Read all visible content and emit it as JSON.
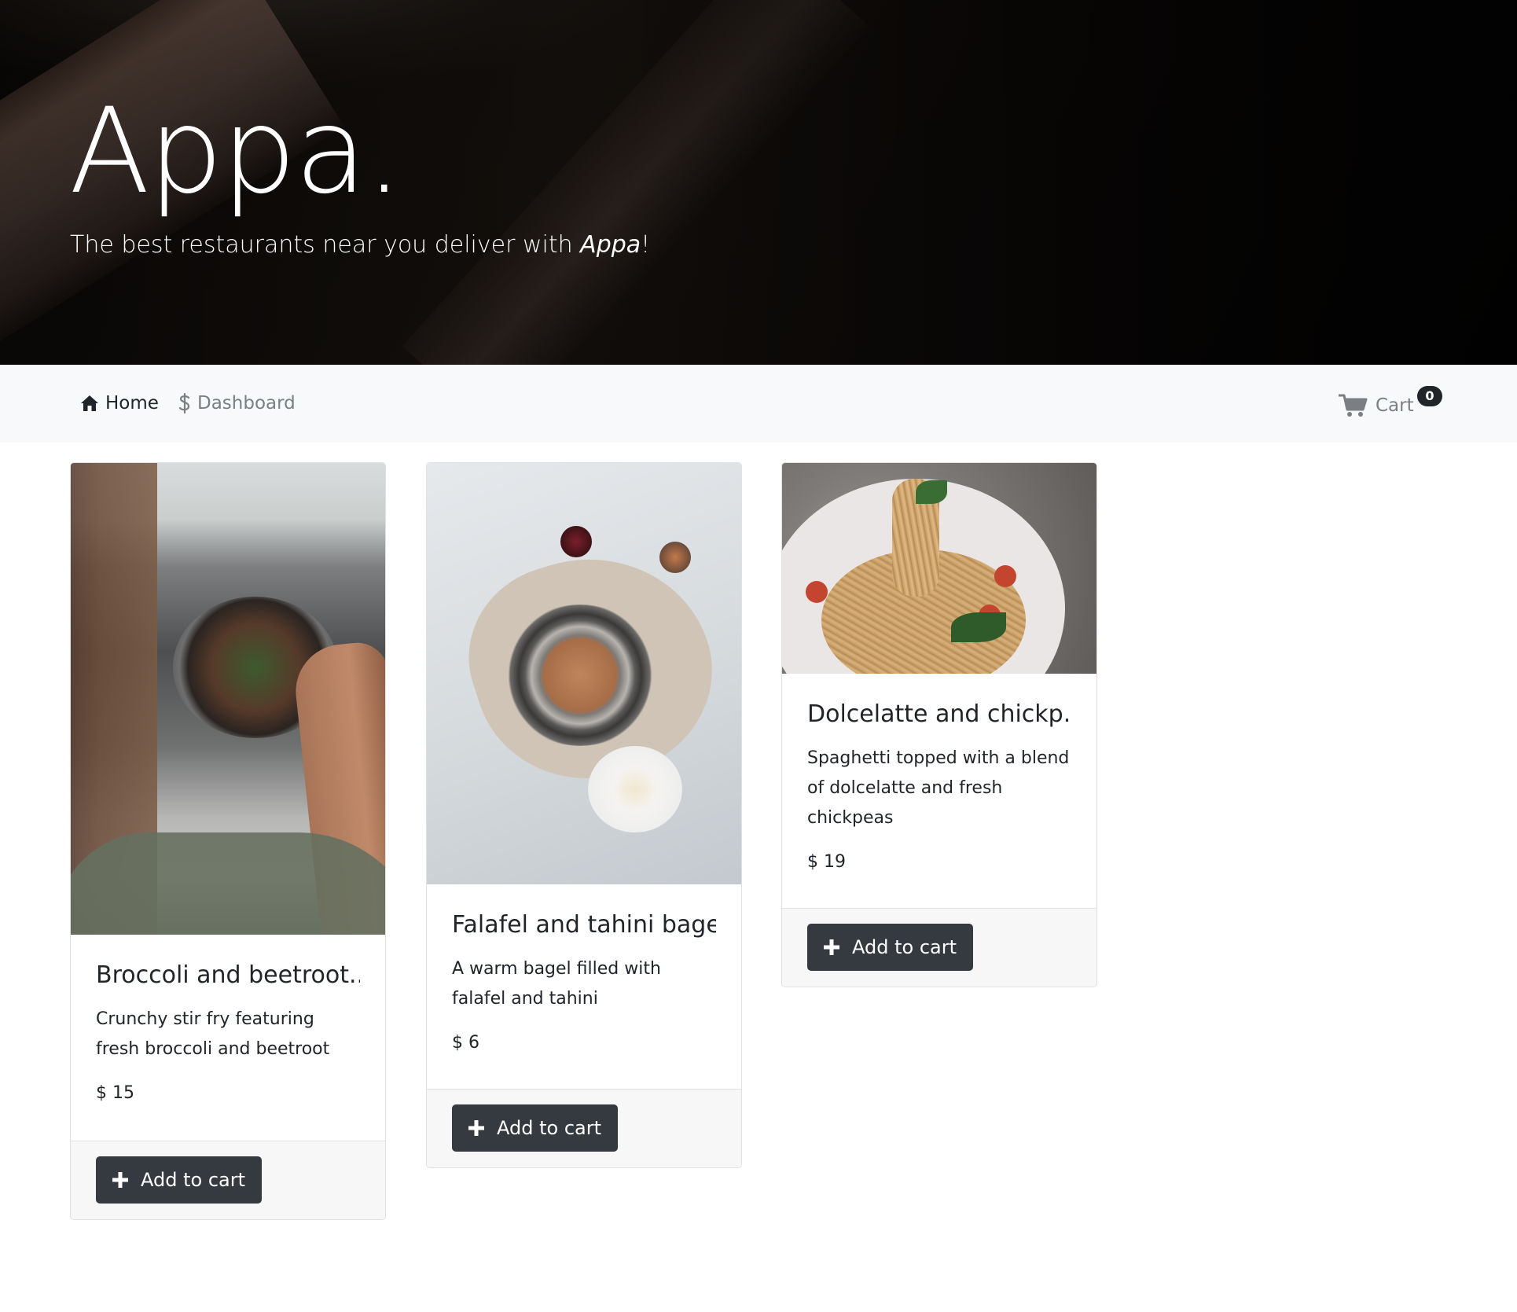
{
  "hero": {
    "title": "Appa.",
    "subtitle_before": "The best restaurants near you deliver with ",
    "subtitle_brand": "Appa",
    "subtitle_after": "!"
  },
  "nav": {
    "home": "Home",
    "dashboard": "Dashboard",
    "cart": "Cart",
    "cart_count": "0"
  },
  "products": [
    {
      "title": "Broccoli and beetroot...",
      "description": "Crunchy stir fry featuring fresh broccoli and beetroot",
      "price": "$ 15",
      "button": "Add to cart"
    },
    {
      "title": "Falafel and tahini bagel",
      "description": "A warm bagel filled with falafel and tahini",
      "price": "$ 6",
      "button": "Add to cart"
    },
    {
      "title": "Dolcelatte and chickp...",
      "description": "Spaghetti topped with a blend of dolcelatte and fresh chickpeas",
      "price": "$ 19",
      "button": "Add to cart"
    }
  ],
  "colors": {
    "navbar_bg": "#f8f9fa",
    "button_bg": "#343a40",
    "badge_bg": "#212529",
    "muted_link": "#7a7f84"
  },
  "icons": {
    "home": "home-icon",
    "dashboard": "dollar-icon",
    "cart": "cart-icon",
    "add": "plus-icon"
  }
}
